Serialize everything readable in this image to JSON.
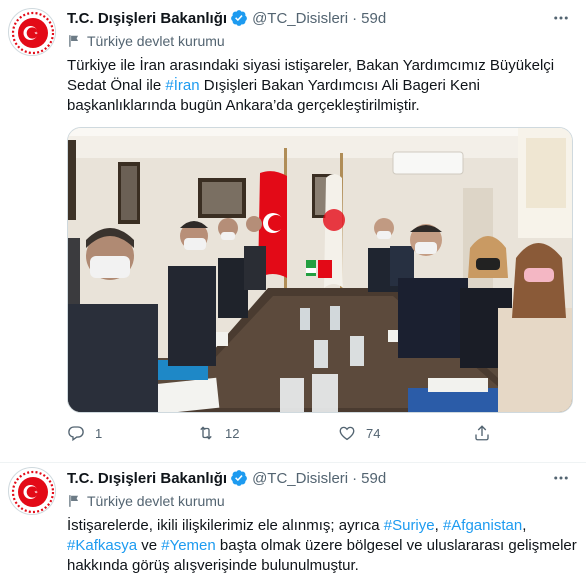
{
  "tweets": [
    {
      "author_name": "T.C. Dışişleri Bakanlığı",
      "handle": "@TC_Disisleri",
      "separator": "·",
      "time": "59d",
      "account_label": "Türkiye devlet kurumu",
      "text_parts": [
        "Türkiye ile İran arasındaki siyasi istişareler, Bakan Yardımcımız Büyükelçi Sedat Önal ile ",
        "#İran",
        " Dışişleri Bakan Yardımcısı Ali Bageri Keni başkanlıklarında bugün Ankara’da gerçekleştirilmiştir."
      ],
      "actions": {
        "replies": "1",
        "retweets": "12",
        "likes": "74"
      }
    },
    {
      "author_name": "T.C. Dışişleri Bakanlığı",
      "handle": "@TC_Disisleri",
      "separator": "·",
      "time": "59d",
      "account_label": "Türkiye devlet kurumu",
      "text_parts": [
        "İstişarelerde, ikili ilişkilerimiz ele alınmış; ayrıca ",
        "#Suriye",
        ", ",
        "#Afganistan",
        ", ",
        "#Kafkasya",
        " ve ",
        "#Yemen",
        " başta olmak üzere bölgesel ve uluslararası gelişmeler hakkında görüş alışverişinde bulunulmuştur."
      ]
    }
  ],
  "colors": {
    "link": "#1d9bf0",
    "verified": "#1d9bf0",
    "muted": "#536471",
    "turkey_red": "#e30a17"
  },
  "icons": [
    "more-icon",
    "verified-badge-icon",
    "government-flag-icon",
    "reply-icon",
    "retweet-icon",
    "like-icon",
    "share-icon",
    "ministry-logo-icon"
  ]
}
